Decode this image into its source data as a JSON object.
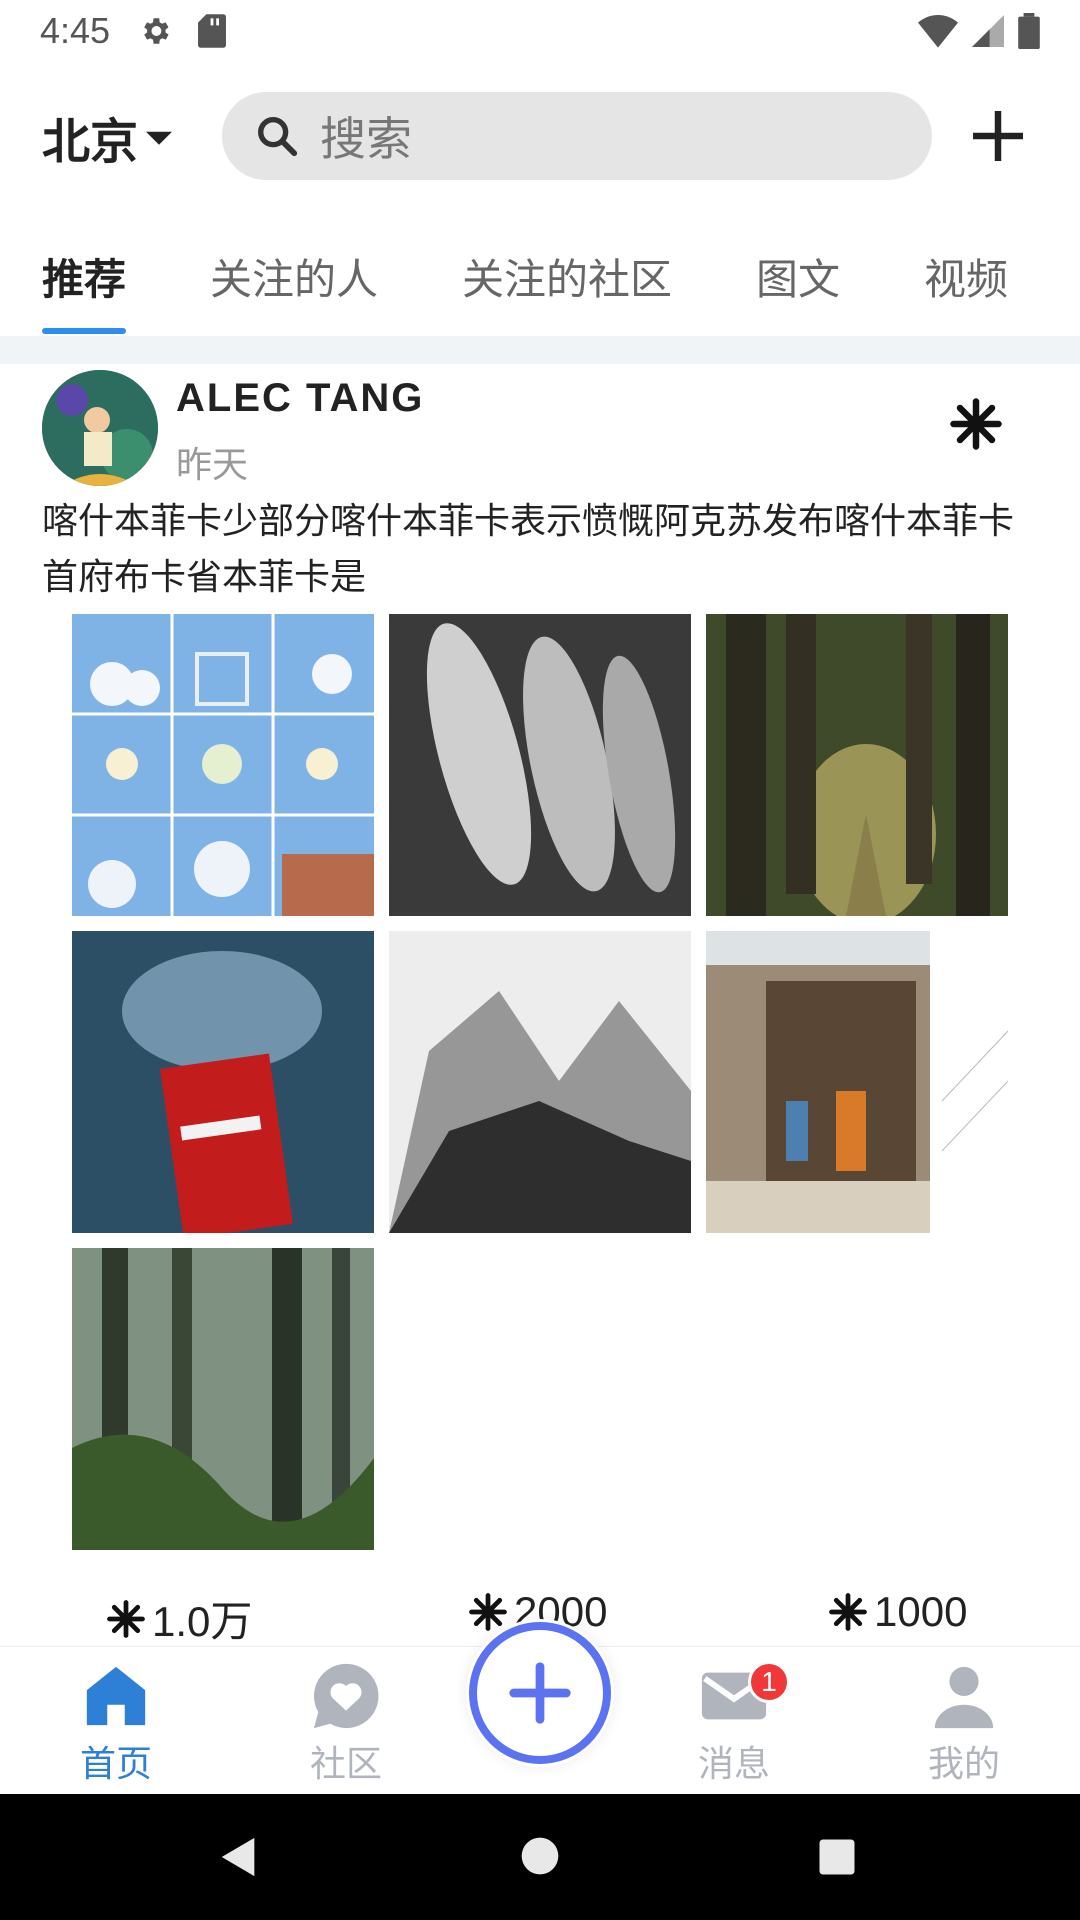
{
  "status_bar": {
    "time": "4:45"
  },
  "header": {
    "city": "北京",
    "search_placeholder": "搜索"
  },
  "tabs": [
    {
      "label": "推荐"
    },
    {
      "label": "关注的人"
    },
    {
      "label": "关注的社区"
    },
    {
      "label": "图文"
    },
    {
      "label": "视频"
    }
  ],
  "post": {
    "author": "ALEC TANG",
    "time": "昨天",
    "text": "喀什本菲卡少部分喀什本菲卡表示愤慨阿克苏发布喀什本菲卡首府布卡省本菲卡是",
    "stats": [
      {
        "value": "1.0万"
      },
      {
        "value": "2000"
      },
      {
        "value": "1000"
      }
    ]
  },
  "bottom_nav": {
    "items": [
      {
        "label": "首页"
      },
      {
        "label": "社区"
      },
      {
        "label": "消息"
      },
      {
        "label": "我的"
      }
    ],
    "message_badge": "1"
  },
  "colors": {
    "accent": "#2e7fd6",
    "fab": "#5b73f0",
    "badge": "#f0383a",
    "inactive": "#b0b4bd"
  }
}
